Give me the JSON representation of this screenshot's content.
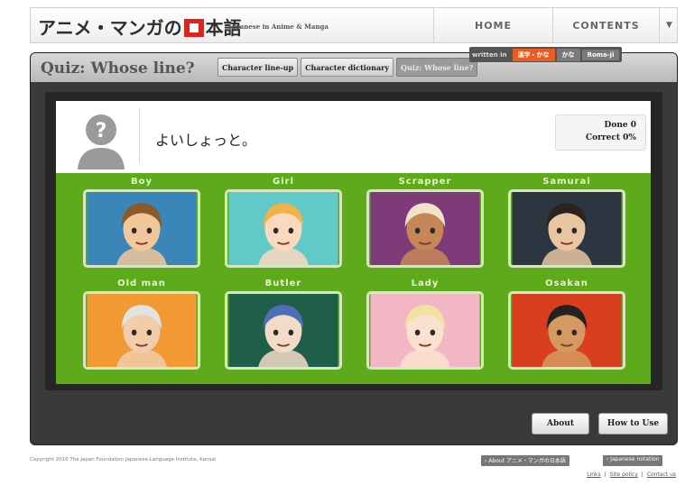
{
  "header": {
    "logo_text_a": "アニメ・マンガの",
    "logo_text_b": "本語",
    "tagline": "Japanese in Anime & Manga",
    "nav_home": "HOME",
    "nav_contents": "CONTENTS"
  },
  "writing": {
    "label": "written in",
    "options": [
      "漢字・かな",
      "かな",
      "Roma-ji"
    ],
    "active": 0
  },
  "page": {
    "title": "Quiz: Whose line?",
    "tabs": [
      "Character line-up",
      "Character dictionary",
      "Quiz: Whose line?"
    ],
    "active_tab": 2
  },
  "quiz": {
    "question": "よいしょっと。",
    "done_label": "Done",
    "done_value": "0",
    "correct_label": "Correct",
    "correct_value": "0%"
  },
  "characters": [
    {
      "name": "Boy",
      "bg": "#3a86b8",
      "skin": "#f2c79a",
      "hair": "#8a5a2b"
    },
    {
      "name": "Girl",
      "bg": "#62c9c9",
      "skin": "#fbd9bf",
      "hair": "#f0b24a"
    },
    {
      "name": "Scrapper",
      "bg": "#7d3b7a",
      "skin": "#c58757",
      "hair": "#efe4c8"
    },
    {
      "name": "Samurai",
      "bg": "#2b3641",
      "skin": "#e8c6a2",
      "hair": "#2a241f"
    },
    {
      "name": "Old man",
      "bg": "#f19a34",
      "skin": "#f2cda9",
      "hair": "#e2e2e2"
    },
    {
      "name": "Butler",
      "bg": "#1f5f4a",
      "skin": "#f2dbc8",
      "hair": "#4d6fb8"
    },
    {
      "name": "Lady",
      "bg": "#f2b6c5",
      "skin": "#fbe2cf",
      "hair": "#f3e1a2"
    },
    {
      "name": "Osakan",
      "bg": "#d93e1e",
      "skin": "#d49a62",
      "hair": "#222222"
    }
  ],
  "buttons": {
    "about": "About",
    "how_to_use": "How to Use"
  },
  "footer": {
    "copyright": "Copyright 2010 The Japan Foundation Japanese-Language Institute, Kansai",
    "about_btn": "› About アニメ・マンガの日本語",
    "notation_btn": "› Japanese notation",
    "links": [
      "Links",
      "Site policy",
      "Contact us"
    ]
  }
}
